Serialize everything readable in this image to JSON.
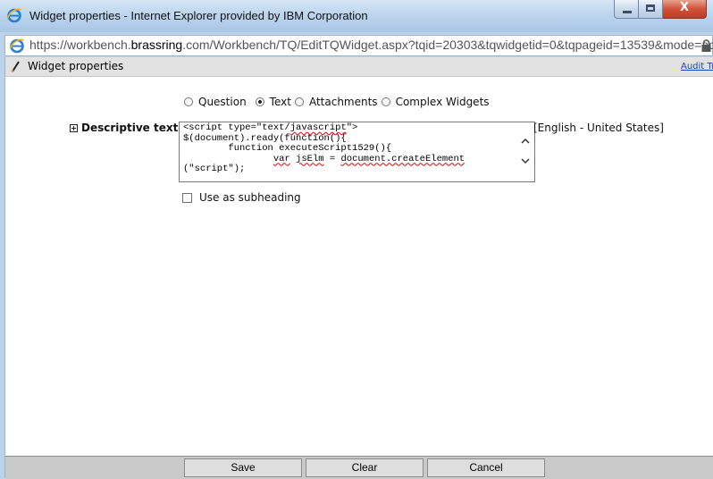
{
  "window": {
    "title": "Widget properties - Internet Explorer provided by IBM Corporation",
    "close_glyph": "X"
  },
  "address": {
    "url_prefix": "https://workbench.",
    "url_domain": "brassring",
    "url_suffix": ".com/Workbench/TQ/EditTQWidget.aspx?tqid=20303&tqwidgetid=0&tqpageid=13539&mode=ac"
  },
  "header": {
    "title": "Widget properties",
    "audit_link": "Audit Tra"
  },
  "widget_types": {
    "options": [
      "Question",
      "Text",
      "Attachments",
      "Complex Widgets"
    ],
    "selected": "Text"
  },
  "descriptive_text": {
    "label": "Descriptive text",
    "lines": [
      "<script type=\"text/javascript\">",
      "$(document).ready(function(){",
      "        function executeScript1529(){",
      "                var jsElm = document.createElement",
      "(\"script\");"
    ],
    "language": "[English - United States]"
  },
  "subheading": {
    "label": "Use as subheading",
    "checked": false
  },
  "footer": {
    "save_label": "Save",
    "clear_label": "Clear",
    "cancel_label": "Cancel"
  },
  "colors": {
    "title_bar": "#bcd3ea",
    "close_button": "#c8432a",
    "footer_bar": "#c9c9c9",
    "link": "#1f3fae"
  },
  "icons": [
    "ie-logo-icon",
    "minimize-icon",
    "maximize-icon",
    "close-icon",
    "lock-icon",
    "pencil-icon",
    "expand-icon",
    "scroll-up-icon",
    "scroll-down-icon"
  ]
}
